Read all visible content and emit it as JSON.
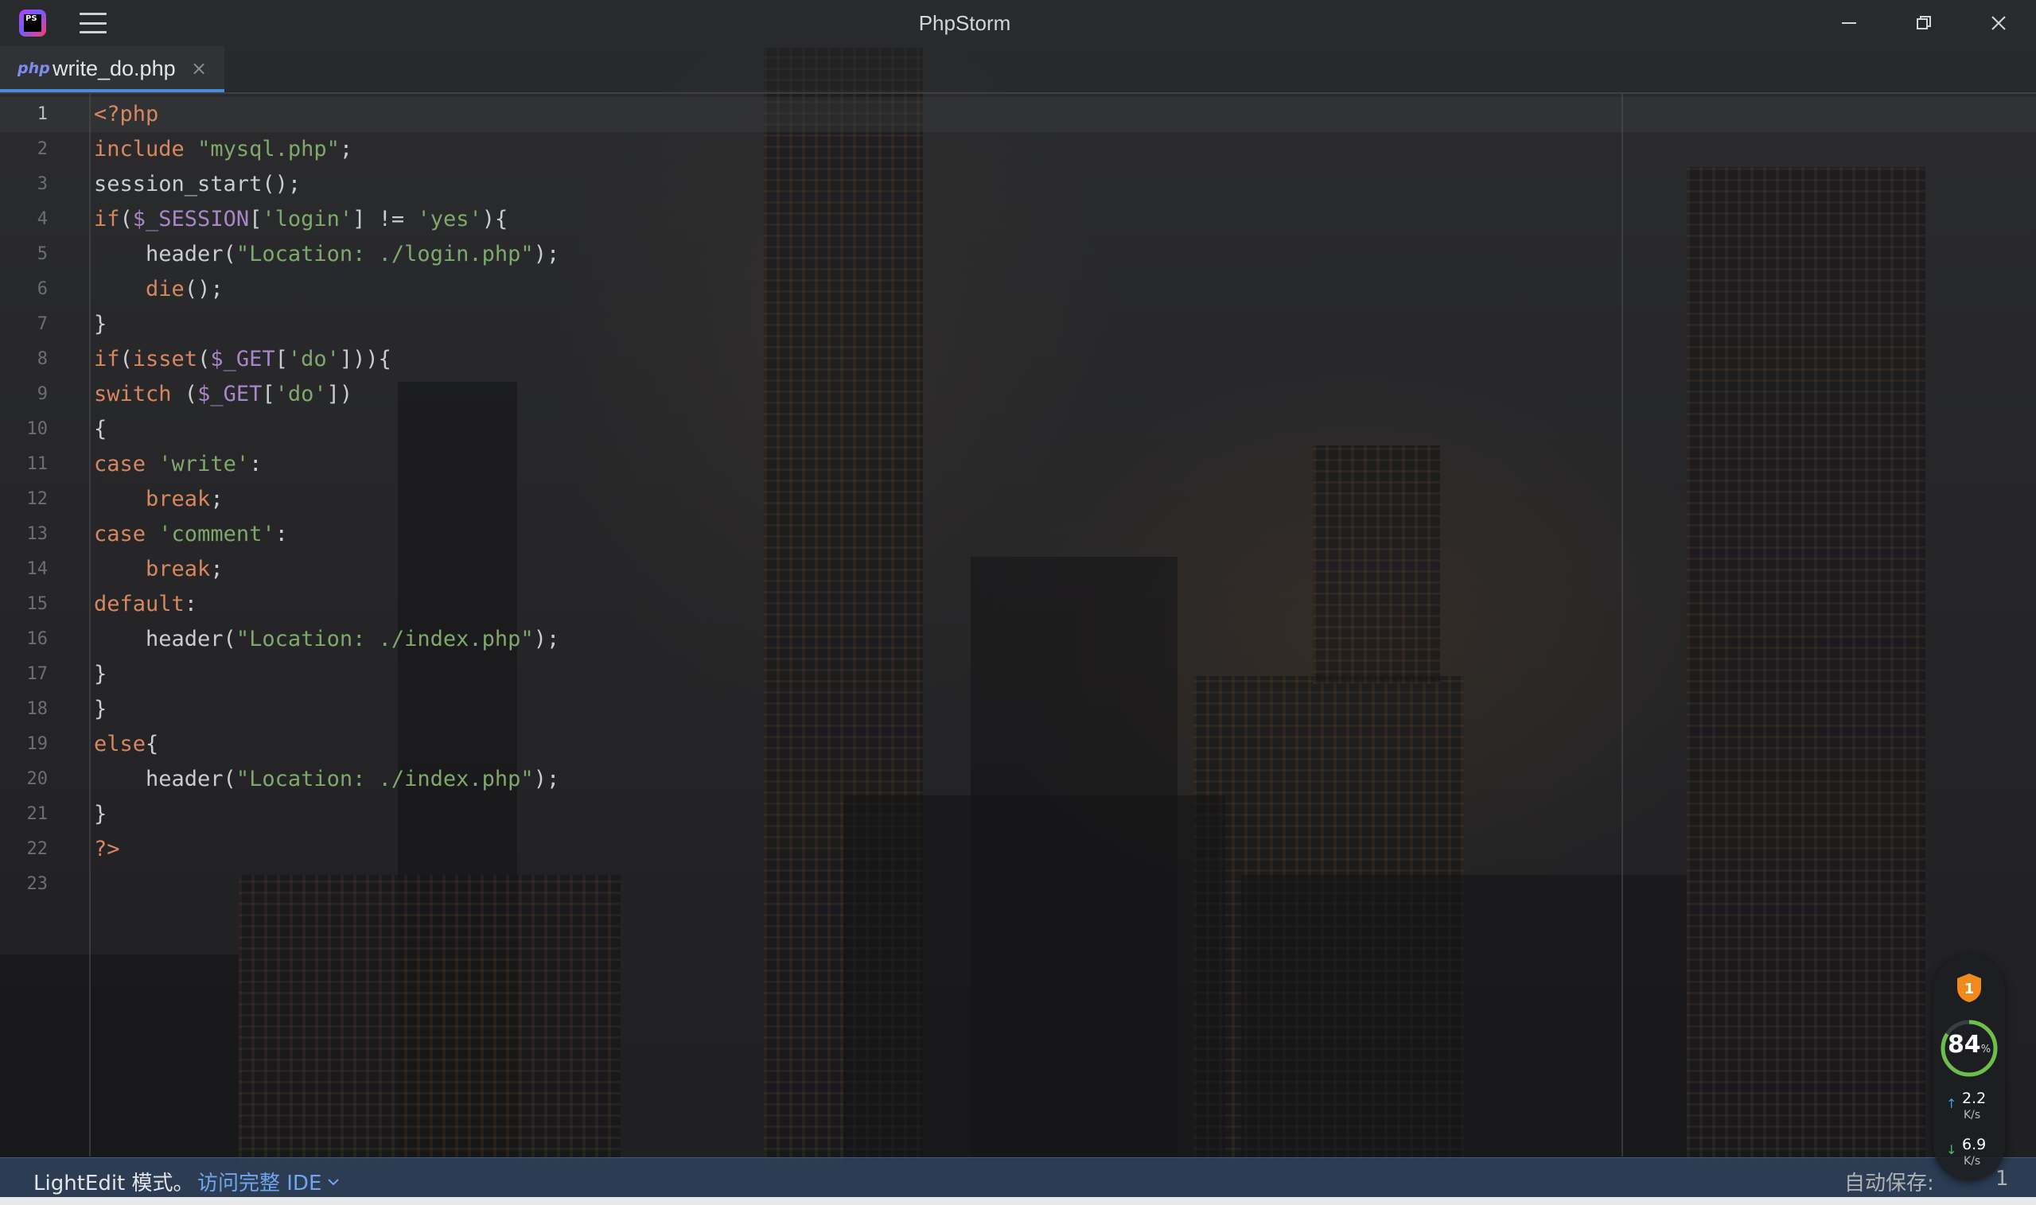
{
  "window": {
    "title": "PhpStorm",
    "logo_text": "PS"
  },
  "tab": {
    "icon_label": "php",
    "file_name": "write_do.php",
    "close_glyph": "×"
  },
  "editor": {
    "current_line": 1,
    "lines": [
      {
        "n": "1",
        "html": "<span class=\"tag\">&lt;?php</span>"
      },
      {
        "n": "2",
        "html": "<span class=\"kw\">include</span> <span class=\"str\">\"mysql.php\"</span>;"
      },
      {
        "n": "3",
        "html": "session_start();"
      },
      {
        "n": "4",
        "html": "<span class=\"kw\">if</span>(<span class=\"var\">$_SESSION</span>[<span class=\"str\">'login'</span>] != <span class=\"str\">'yes'</span>){"
      },
      {
        "n": "5",
        "html": "    header(<span class=\"str\">\"Location: ./login.php\"</span>);"
      },
      {
        "n": "6",
        "html": "    <span class=\"kw\">die</span>();"
      },
      {
        "n": "7",
        "html": "}"
      },
      {
        "n": "8",
        "html": "<span class=\"kw\">if</span>(<span class=\"kw\">isset</span>(<span class=\"var\">$_GET</span>[<span class=\"str\">'do'</span>])){"
      },
      {
        "n": "9",
        "html": "<span class=\"kw\">switch</span> (<span class=\"var\">$_GET</span>[<span class=\"str\">'do'</span>])"
      },
      {
        "n": "10",
        "html": "{"
      },
      {
        "n": "11",
        "html": "<span class=\"kw\">case</span> <span class=\"str\">'write'</span>:"
      },
      {
        "n": "12",
        "html": "    <span class=\"kw\">break</span>;"
      },
      {
        "n": "13",
        "html": "<span class=\"kw\">case</span> <span class=\"str\">'comment'</span>:"
      },
      {
        "n": "14",
        "html": "    <span class=\"kw\">break</span>;"
      },
      {
        "n": "15",
        "html": "<span class=\"kw\">default</span>:"
      },
      {
        "n": "16",
        "html": "    header(<span class=\"str\">\"Location: ./index.php\"</span>);"
      },
      {
        "n": "17",
        "html": "}"
      },
      {
        "n": "18",
        "html": "}"
      },
      {
        "n": "19",
        "html": "<span class=\"kw\">else</span>{"
      },
      {
        "n": "20",
        "html": "    header(<span class=\"str\">\"Location: ./index.php\"</span>);"
      },
      {
        "n": "21",
        "html": "}"
      },
      {
        "n": "22",
        "html": "<span class=\"tag\">?&gt;</span>"
      },
      {
        "n": "23",
        "html": ""
      }
    ]
  },
  "statusbar": {
    "mode": "LightEdit 模式。",
    "full_ide_link": "访问完整 IDE",
    "autosave": "自动保存:",
    "extra": "1"
  },
  "monitor": {
    "shield_badge": "1",
    "percent": 84,
    "percent_text": "84",
    "percent_unit": "%",
    "upload_value": "2.2",
    "upload_unit": "K/s",
    "download_value": "6.9",
    "download_unit": "K/s"
  },
  "colors": {
    "accent": "#4a8cd9",
    "keyword": "#d7875f",
    "string": "#7fa86b",
    "variable": "#a886c8",
    "statusbar": "#2e425c"
  }
}
